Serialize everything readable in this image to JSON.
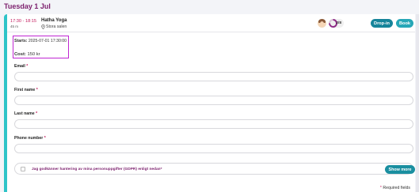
{
  "day": {
    "heading": "Tuesday 1 Jul"
  },
  "session": {
    "time": "17:30 - 18:15",
    "duration": "45 m",
    "class_name": "Hatha Yoga",
    "location": "Stora salen",
    "capacity": "2/8",
    "capacity_fill": 0.25
  },
  "actions": {
    "dropin_label": "Drop-in",
    "book_label": "Book"
  },
  "details": {
    "starts_label": "Starts:",
    "starts_value": "2025-07-01 17:30:00",
    "cost_label": "Cost:",
    "cost_value": "150 kr"
  },
  "form": {
    "email_label": "Email",
    "first_name_label": "First name",
    "last_name_label": "Last name",
    "phone_label": "Phone number",
    "required_marker": "*",
    "consent_text": "Jag godkänner hantering av mina personuppgifter (GDPR) enligt nedan",
    "consent_marker": "*",
    "show_more_label": "Show more",
    "required_note": "Required fields"
  },
  "colors": {
    "accent": "#7c1f6d",
    "teal": "#1a8fa0",
    "stripe": "#2ec4c8",
    "highlight": "#c026d3"
  }
}
